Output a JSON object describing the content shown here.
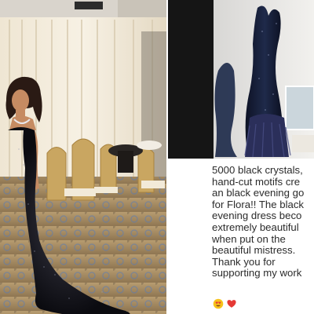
{
  "images": {
    "left_photo": {
      "subject": "woman in black sequined mermaid evening gown with train in an event hall"
    },
    "right_photo": {
      "subject": "black crystal evening gown with feather hem displayed on a mannequin"
    }
  },
  "caption": {
    "text": "5000 black crystals,\nhand-cut motifs cre\nan black evening go\nfor Flora!! The black\nevening dress beco\nextremely beautiful\nwhen put on the\nbeautiful mistress.\nThank you for\nsupporting my work"
  },
  "icons": [
    "heart-eyes-emoji-icon",
    "red-heart-emoji-icon"
  ],
  "colors": {
    "caption_text": "#2b2b2b",
    "heart": "#e53935",
    "emoji_face": "#f7c21a"
  }
}
